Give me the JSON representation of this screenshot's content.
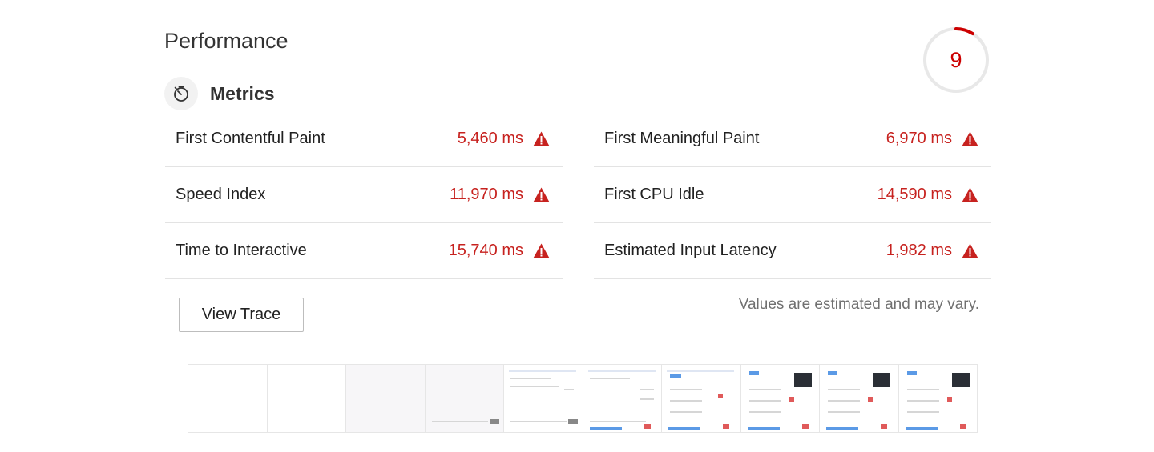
{
  "header": {
    "title": "Performance"
  },
  "score": {
    "value": "9",
    "fraction": 0.09,
    "color": "#cc0000"
  },
  "section": {
    "title": "Metrics",
    "icon": "stopwatch-icon"
  },
  "metrics": {
    "left": [
      {
        "name": "First Contentful Paint",
        "value": "5,460 ms",
        "status_icon": "warning-triangle-icon"
      },
      {
        "name": "Speed Index",
        "value": "11,970 ms",
        "status_icon": "warning-triangle-icon"
      },
      {
        "name": "Time to Interactive",
        "value": "15,740 ms",
        "status_icon": "warning-triangle-icon"
      }
    ],
    "right": [
      {
        "name": "First Meaningful Paint",
        "value": "6,970 ms",
        "status_icon": "warning-triangle-icon"
      },
      {
        "name": "First CPU Idle",
        "value": "14,590 ms",
        "status_icon": "warning-triangle-icon"
      },
      {
        "name": "Estimated Input Latency",
        "value": "1,982 ms",
        "status_icon": "warning-triangle-icon"
      }
    ]
  },
  "actions": {
    "view_trace_label": "View Trace"
  },
  "note": "Values are estimated and may vary.",
  "colors": {
    "fail": "#c7221f",
    "gauge_track": "#e8e8e8",
    "warning_icon": "#c7221f"
  },
  "filmstrip": {
    "frame_count": 10
  }
}
